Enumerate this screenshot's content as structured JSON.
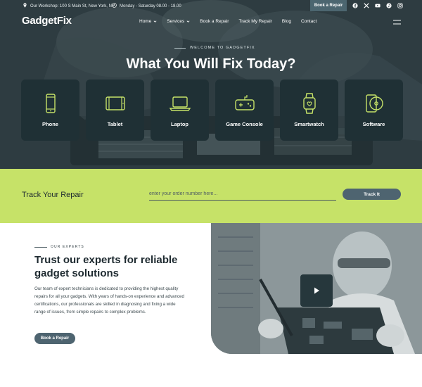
{
  "topbar": {
    "address": "Our Workshop: 100 S Main St, New York, NY",
    "hours": "Monday - Saturday 08.00 - 18.00",
    "book_label": "Book a Repair",
    "socials": [
      "facebook-icon",
      "x-twitter-icon",
      "youtube-icon",
      "pinterest-icon",
      "instagram-icon"
    ]
  },
  "header": {
    "logo": "GadgetFix",
    "nav": [
      "Home",
      "Services",
      "Book a Repair",
      "Track My Repair",
      "Blog",
      "Contact"
    ]
  },
  "hero": {
    "eyebrow": "WELCOME TO GADGETFIX",
    "title": "What You Will Fix Today?",
    "categories": [
      {
        "label": "Phone",
        "icon": "phone-icon"
      },
      {
        "label": "Tablet",
        "icon": "tablet-icon"
      },
      {
        "label": "Laptop",
        "icon": "laptop-icon"
      },
      {
        "label": "Game Console",
        "icon": "gamepad-icon"
      },
      {
        "label": "Smartwatch",
        "icon": "smartwatch-icon"
      },
      {
        "label": "Software",
        "icon": "software-disc-icon"
      }
    ]
  },
  "track": {
    "title": "Track Your Repair",
    "placeholder": "enter your order number here...",
    "button": "Track It"
  },
  "experts": {
    "eyebrow": "OUR EXPERTS",
    "title": "Trust our experts for reliable gadget solutions",
    "body": "Our team of expert technicians is dedicated to providing the highest quality repairs for all your gadgets. With years of hands-on experience and advanced certifications, our professionals are skilled in diagnosing and fixing a wide range of issues, from simple repairs to complex problems.",
    "button": "Book a Repair",
    "video_icon": "play-icon"
  },
  "colors": {
    "accent": "#c6e268",
    "dark": "#1f3035",
    "button": "#4e6470"
  }
}
